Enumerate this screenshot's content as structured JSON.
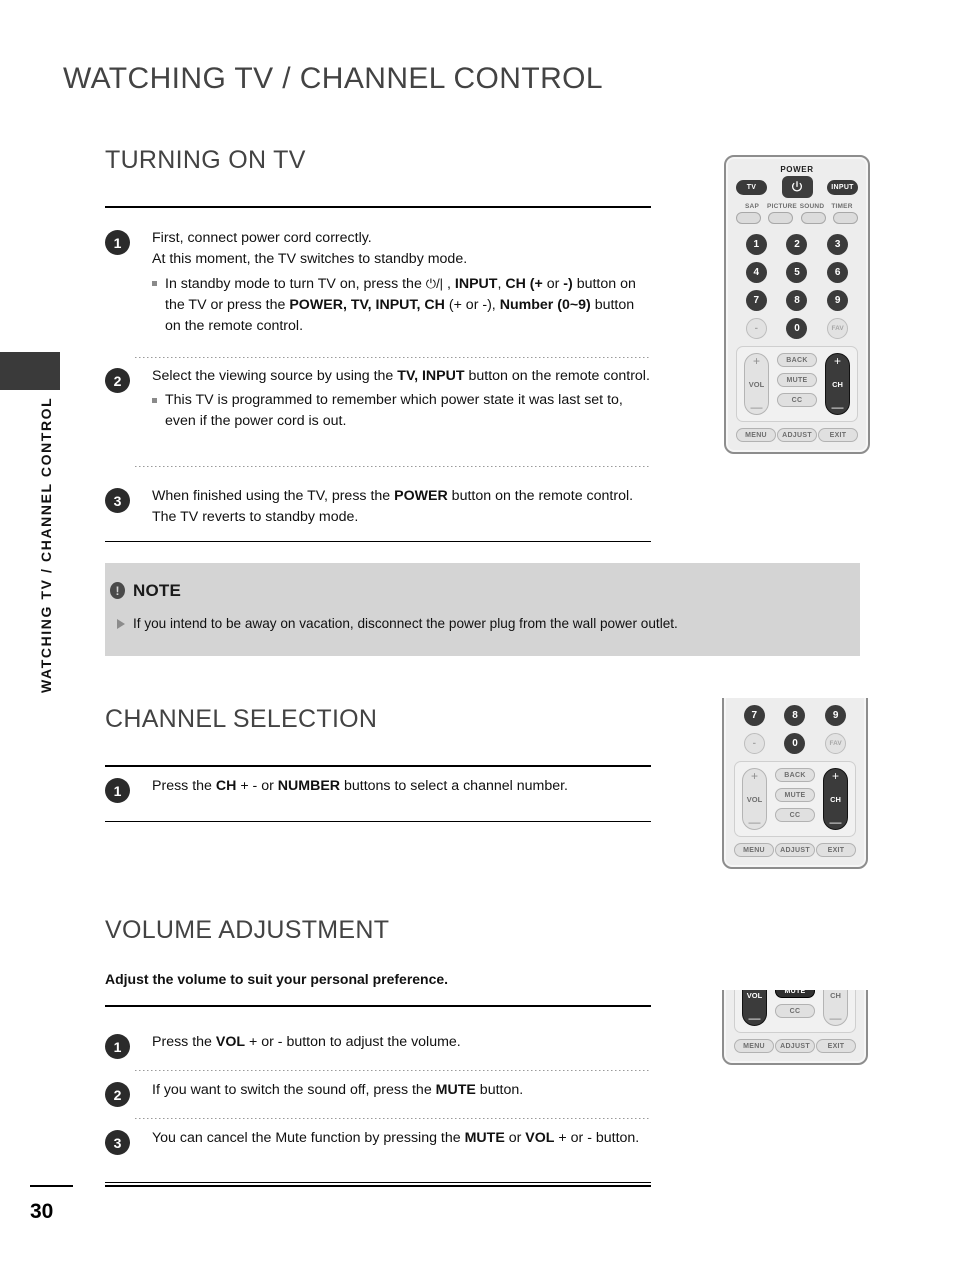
{
  "header": {
    "title": "WATCHING TV / CHANNEL CONTROL"
  },
  "sidebar": {
    "vertical_label": "WATCHING TV / CHANNEL CONTROL"
  },
  "footer": {
    "page_number": "30"
  },
  "sections": {
    "turning_on_tv": {
      "title": "TURNING ON TV",
      "steps": [
        {
          "num": "1",
          "line1": "First, connect power cord correctly.",
          "line2": "At this moment, the TV switches to standby mode.",
          "bullet_a": "In standby mode to turn TV on, press the ",
          "bullet_b": "⏻/|",
          "bullet_c": " , ",
          "bullet_d": "INPUT",
          "bullet_e": ", ",
          "bullet_f": "CH (+",
          "bullet_g": " or ",
          "bullet_h": "-)",
          "bullet_i": " button on the TV or press the ",
          "bullet_j": "POWER, TV, INPUT, CH",
          "bullet_k": " (+ or -), ",
          "bullet_l": "Number (0~9)",
          "bullet_m": " button on the remote control."
        },
        {
          "num": "2",
          "line_pre": "Select the viewing source by using the ",
          "line_bold": "TV, INPUT",
          "line_post": " button on the remote control.",
          "bullet": "This TV is programmed to remember which power state it was last set to, even if the power cord is out."
        },
        {
          "num": "3",
          "line_pre": "When finished using the TV, press the ",
          "line_bold": "POWER",
          "line_post": " button on the remote control. The TV reverts to standby mode."
        }
      ]
    },
    "note": {
      "title": "NOTE",
      "bang": "!",
      "items": [
        "If you intend to be away on vacation, disconnect the power plug from the wall power outlet."
      ]
    },
    "channel_selection": {
      "title": "CHANNEL SELECTION",
      "steps": [
        {
          "num": "1",
          "pre": "Press the ",
          "bold1": "CH",
          "mid": " + -  or ",
          "bold2": "NUMBER",
          "post": " buttons to select a channel number."
        }
      ]
    },
    "volume_adjustment": {
      "title": "VOLUME ADJUSTMENT",
      "lead": "Adjust the volume to suit your personal preference.",
      "steps": [
        {
          "num": "1",
          "pre": "Press the ",
          "bold1": "VOL",
          "post": " + or -  button to adjust the volume."
        },
        {
          "num": "2",
          "pre": "If you want to switch the sound off, press the ",
          "bold1": "MUTE",
          "post": " button."
        },
        {
          "num": "3",
          "pre": "You can cancel the Mute function by pressing the ",
          "bold1": "MUTE",
          "mid": " or ",
          "bold2": "VOL",
          "post": " + or - button."
        }
      ]
    }
  },
  "remote": {
    "power_label": "POWER",
    "tv_button": "TV",
    "input_button": "INPUT",
    "power_icon": "power-icon",
    "function_labels": [
      "SAP",
      "PICTURE",
      "SOUND",
      "TIMER"
    ],
    "numpad": [
      [
        "1",
        "2",
        "3"
      ],
      [
        "4",
        "5",
        "6"
      ],
      [
        "7",
        "8",
        "9"
      ],
      [
        "-",
        "0",
        "FAV"
      ]
    ],
    "vol_label": "VOL",
    "ch_label": "CH",
    "plus": "+",
    "minus": "—",
    "back": "BACK",
    "mute": "MUTE",
    "cc": "CC",
    "menu": "MENU",
    "adjust": "ADJUST",
    "exit": "EXIT"
  }
}
